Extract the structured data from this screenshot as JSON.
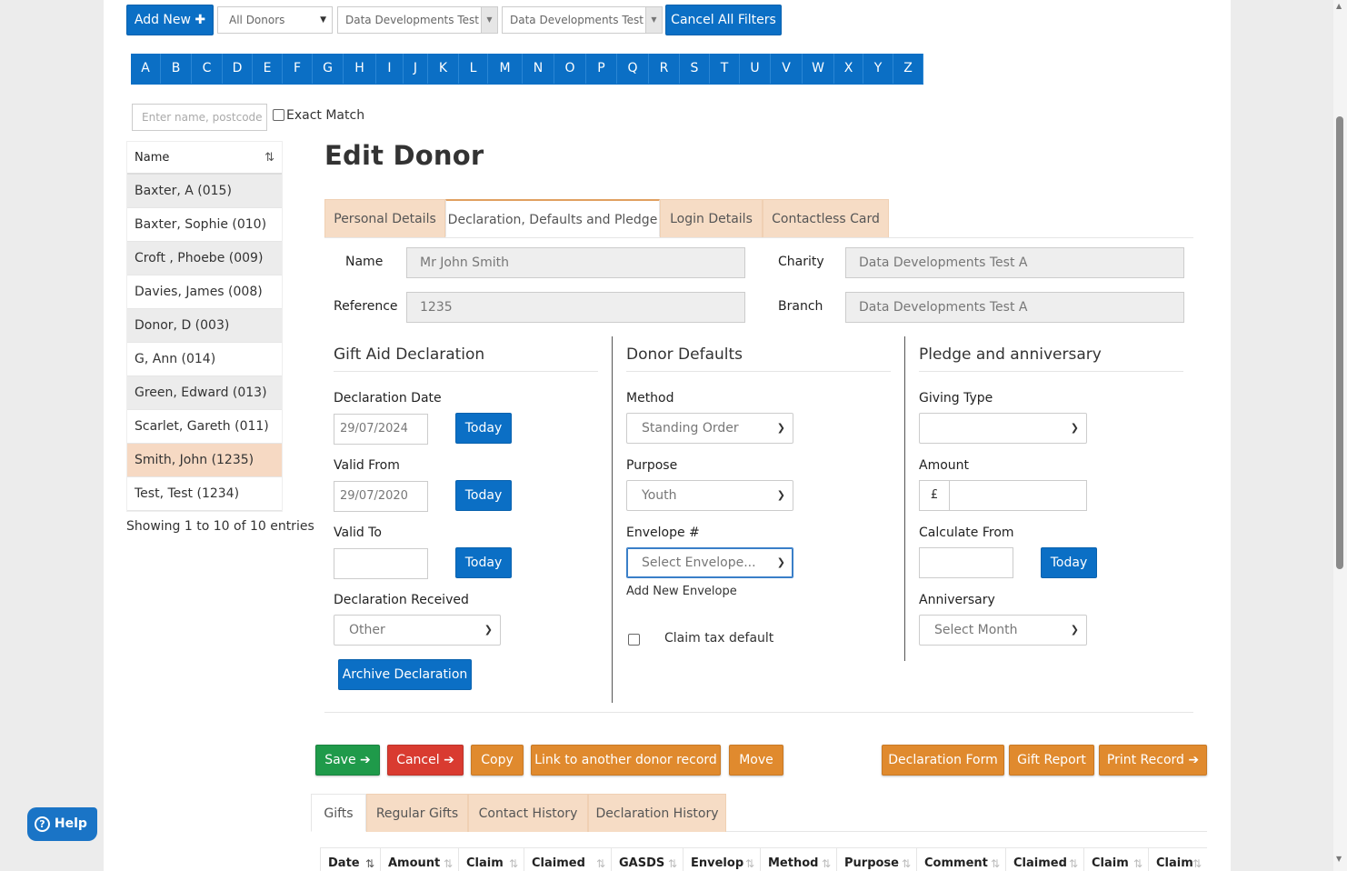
{
  "toolbar": {
    "add_new": "Add New",
    "donor_filter": "All Donors",
    "charity_filter": "Data Developments Test A",
    "branch_filter": "Data Developments Test A",
    "cancel_filters": "Cancel All Filters"
  },
  "alphabet": [
    "A",
    "B",
    "C",
    "D",
    "E",
    "F",
    "G",
    "H",
    "I",
    "J",
    "K",
    "L",
    "M",
    "N",
    "O",
    "P",
    "Q",
    "R",
    "S",
    "T",
    "U",
    "V",
    "W",
    "X",
    "Y",
    "Z"
  ],
  "search": {
    "placeholder": "Enter name, postcode or",
    "exact_match": "Exact Match"
  },
  "donor_list": {
    "header": "Name",
    "items": [
      "Baxter, A (015)",
      "Baxter, Sophie (010)",
      "Croft , Phoebe (009)",
      "Davies, James (008)",
      "Donor, D (003)",
      "G, Ann (014)",
      "Green, Edward (013)",
      "Scarlet, Gareth (011)",
      "Smith, John (1235)",
      "Test, Test (1234)"
    ],
    "selected_index": 8,
    "footer": "Showing 1 to 10 of 10 entries"
  },
  "page_title": "Edit Donor",
  "tabs": [
    "Personal Details",
    "Declaration, Defaults and Pledge",
    "Login Details",
    "Contactless Card"
  ],
  "active_tab": 1,
  "identity": {
    "name_label": "Name",
    "name_value": "Mr John Smith",
    "reference_label": "Reference",
    "reference_value": "1235",
    "charity_label": "Charity",
    "charity_value": "Data Developments Test A",
    "branch_label": "Branch",
    "branch_value": "Data Developments Test A"
  },
  "gift_aid": {
    "title": "Gift Aid Declaration",
    "declaration_date_label": "Declaration Date",
    "declaration_date": "29/07/2024",
    "valid_from_label": "Valid From",
    "valid_from": "29/07/2020",
    "valid_to_label": "Valid To",
    "valid_to": "",
    "today": "Today",
    "received_label": "Declaration Received",
    "received_value": "Other",
    "archive": "Archive Declaration"
  },
  "defaults": {
    "title": "Donor Defaults",
    "method_label": "Method",
    "method_value": "Standing Order",
    "purpose_label": "Purpose",
    "purpose_value": "Youth",
    "envelope_label": "Envelope #",
    "envelope_value": "Select Envelope...",
    "add_envelope": "Add New Envelope",
    "claim_tax": "Claim tax default"
  },
  "pledge": {
    "title": "Pledge and anniversary",
    "giving_type_label": "Giving Type",
    "giving_type_value": "",
    "amount_label": "Amount",
    "currency": "£",
    "calc_from_label": "Calculate From",
    "today": "Today",
    "anniversary_label": "Anniversary",
    "anniversary_value": "Select Month"
  },
  "actions": {
    "save": "Save",
    "cancel": "Cancel",
    "copy": "Copy",
    "link": "Link to another donor record",
    "move": "Move",
    "declaration_form": "Declaration Form",
    "gift_report": "Gift Report",
    "print_record": "Print Record"
  },
  "bottom_tabs": [
    "Gifts",
    "Regular Gifts",
    "Contact History",
    "Declaration History"
  ],
  "table_headers": [
    "Date",
    "Amount",
    "Claim",
    "Claimed",
    "GASDS",
    "Envelop",
    "Method",
    "Purpose",
    "Comment",
    "Claimed",
    "Claim",
    "Claim"
  ],
  "help": "Help",
  "colors": {
    "blue": "#0b6fc5",
    "orange": "#e08a2e",
    "green": "#1f9a4a",
    "red": "#d93b30",
    "selected_row": "#f6d9c3"
  }
}
